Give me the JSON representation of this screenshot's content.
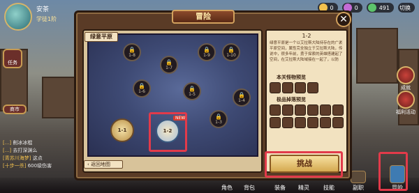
{
  "player": {
    "name": "安茶",
    "level": "学徒1阶"
  },
  "resources": [
    {
      "name": "gold",
      "value": "0",
      "color": "#f2c14e"
    },
    {
      "name": "gem",
      "value": "0",
      "color": "#c46bd6"
    },
    {
      "name": "energy",
      "value": "491",
      "color": "#5cc46b"
    }
  ],
  "top_right": {
    "label": "切换"
  },
  "left_buttons": [
    {
      "label": "任务"
    }
  ],
  "chat": [
    {
      "tag": "[...]",
      "text": "削冰冰棍"
    },
    {
      "tag": "[...]",
      "text": "去打深渊么"
    },
    {
      "tag": "[青苏川海梦]",
      "text": "这点"
    },
    {
      "tag": "[十步一杀]",
      "text": "600级伤害"
    }
  ],
  "shop_label": "商市",
  "panel": {
    "title": "冒险",
    "region": "绿意平原",
    "back_label": "返回地图",
    "new_badge": "NEW"
  },
  "stages": [
    {
      "id": "1-1",
      "locked": false,
      "current": false
    },
    {
      "id": "1-2",
      "locked": false,
      "current": true
    },
    {
      "id": "1-3",
      "locked": true
    },
    {
      "id": "1-4",
      "locked": true
    },
    {
      "id": "1-5",
      "locked": true
    },
    {
      "id": "1-6",
      "locked": true
    },
    {
      "id": "1-7",
      "locked": true
    },
    {
      "id": "1-8",
      "locked": true
    },
    {
      "id": "1-9",
      "locked": true
    },
    {
      "id": "1-10",
      "locked": true
    }
  ],
  "info": {
    "stage": "1-2",
    "description": "绿意平原是一个以艾拉斯大陆持存在的广袤平原空间，属性完全独立于艾拉斯大陆，传说中，很多年前，勇于探索的英雄搭建起了空间，在艾拉斯大陆域接在一起了，以防",
    "monster_title": "本关怪物预览",
    "drop_title": "极品掉落预览",
    "challenge_label": "挑战"
  },
  "right_buttons": [
    {
      "label": "成就"
    },
    {
      "label": "福利活动"
    }
  ],
  "bottom_nav": [
    {
      "label": "角色"
    },
    {
      "label": "背包"
    },
    {
      "label": "装备"
    },
    {
      "label": "精灵"
    },
    {
      "label": "技能"
    },
    {
      "label": "副职"
    },
    {
      "label": "冒险"
    }
  ]
}
